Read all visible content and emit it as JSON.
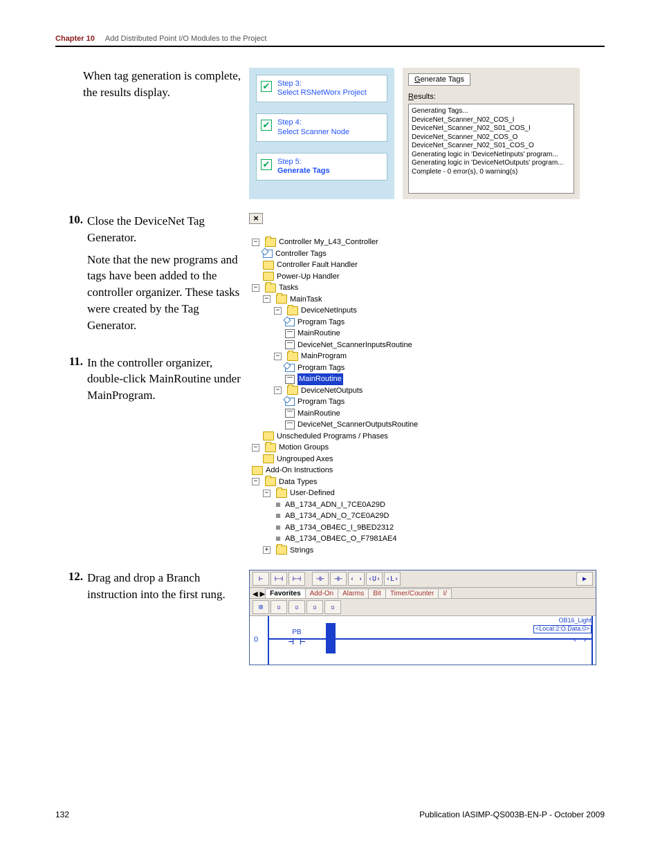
{
  "header": {
    "chapter": "Chapter 10",
    "title": "Add Distributed Point I/O Modules to the Project"
  },
  "intro": "When tag generation is complete, the results display.",
  "fig1": {
    "step3_label": "Step 3:",
    "step3_text": "Select RSNetWorx Project",
    "step4_label": "Step 4:",
    "step4_text": "Select Scanner Node",
    "step5_label": "Step 5:",
    "step5_text": "Generate Tags",
    "generate_btn_prefix": "G",
    "generate_btn_rest": "enerate Tags",
    "results_prefix": "R",
    "results_rest": "esults:",
    "results_body": "Generating Tags...\nDeviceNet_Scanner_N02_COS_I\nDeviceNet_Scanner_N02_S01_COS_I\nDeviceNet_Scanner_N02_COS_O\nDeviceNet_Scanner_N02_S01_COS_O\nGenerating logic in 'DeviceNetInputs' program...\nGenerating logic in 'DeviceNetOutputs' program...\nComplete - 0 error(s), 0 warning(s)"
  },
  "step10": {
    "num": "10.",
    "text1": "Close the DeviceNet Tag Generator.",
    "text2": "Note that the new programs and tags have been added to the controller organizer. These tasks were created by the Tag Generator."
  },
  "step11": {
    "num": "11.",
    "text": "In the controller organizer, double-click MainRoutine under MainProgram."
  },
  "step12": {
    "num": "12.",
    "text": "Drag and drop a Branch instruction into the first rung."
  },
  "tree": {
    "controller": "Controller My_L43_Controller",
    "controller_tags": "Controller Tags",
    "controller_fault": "Controller Fault Handler",
    "powerup": "Power-Up Handler",
    "tasks": "Tasks",
    "maintask": "MainTask",
    "dninputs": "DeviceNetInputs",
    "program_tags": "Program Tags",
    "mainroutine": "MainRoutine",
    "dn_inroutine": "DeviceNet_ScannerInputsRoutine",
    "mainprogram": "MainProgram",
    "dnoutputs": "DeviceNetOutputs",
    "dn_outroutine": "DeviceNet_ScannerOutputsRoutine",
    "unscheduled": "Unscheduled Programs / Phases",
    "motion": "Motion Groups",
    "ungrouped": "Ungrouped Axes",
    "addon": "Add-On Instructions",
    "datatypes": "Data Types",
    "userdef": "User-Defined",
    "udt1": "AB_1734_ADN_I_7CE0A29D",
    "udt2": "AB_1734_ADN_O_7CE0A29D",
    "udt3": "AB_1734_OB4EC_I_9BED2312",
    "udt4": "AB_1734_OB4EC_O_F7981AE4",
    "strings": "Strings"
  },
  "ladder": {
    "tabs": [
      "Favorites",
      "Add-On",
      "Alarms",
      "Bit",
      "Timer/Counter",
      "I/"
    ],
    "toolbar1": [
      "⊢",
      "⊢⊣",
      "⊢⊣",
      "⊣⊢",
      "⊣⊢",
      "‹ ›",
      "‹U›",
      "‹L›"
    ],
    "rung_num": "0",
    "contact_lbl": "PB",
    "out_label1": "OB16_Light",
    "out_label2": "<Local:2:O.Data.0>"
  },
  "footer": {
    "page": "132",
    "pub": "Publication IASIMP-QS003B-EN-P - October 2009"
  }
}
